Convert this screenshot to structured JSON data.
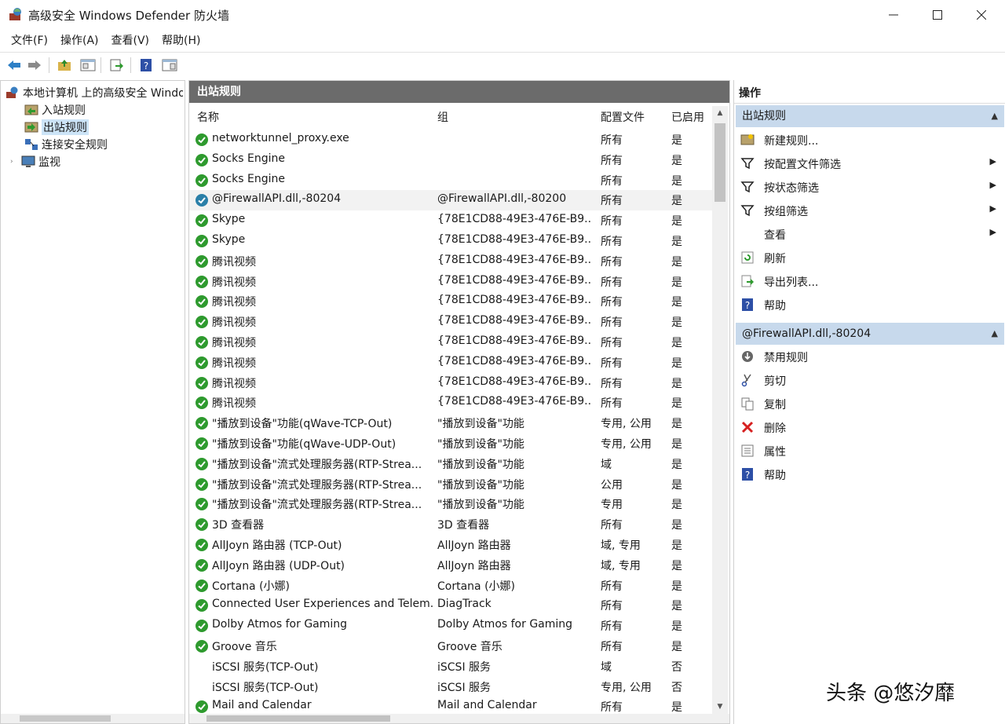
{
  "window": {
    "title": "高级安全 Windows Defender 防火墙"
  },
  "menu": [
    "文件(F)",
    "操作(A)",
    "查看(V)",
    "帮助(H)"
  ],
  "tree": {
    "root": "本地计算机 上的高级安全 Windows",
    "items": [
      {
        "label": "入站规则"
      },
      {
        "label": "出站规则"
      },
      {
        "label": "连接安全规则"
      },
      {
        "label": "监视"
      }
    ]
  },
  "center": {
    "header": "出站规则",
    "columns": {
      "name": "名称",
      "group": "组",
      "profile": "配置文件",
      "enabled": "已启用"
    },
    "rows": [
      {
        "icon": "green-check",
        "name": "networktunnel_proxy.exe",
        "group": "",
        "profile": "所有",
        "enabled": "是"
      },
      {
        "icon": "green-check",
        "name": "Socks Engine",
        "group": "",
        "profile": "所有",
        "enabled": "是"
      },
      {
        "icon": "green-check",
        "name": "Socks Engine",
        "group": "",
        "profile": "所有",
        "enabled": "是"
      },
      {
        "icon": "blue-check",
        "name": "@FirewallAPI.dll,-80204",
        "group": "@FirewallAPI.dll,-80200",
        "profile": "所有",
        "enabled": "是",
        "selected": true
      },
      {
        "icon": "green-check",
        "name": "Skype",
        "group": "{78E1CD88-49E3-476E-B9...",
        "profile": "所有",
        "enabled": "是"
      },
      {
        "icon": "green-check",
        "name": "Skype",
        "group": "{78E1CD88-49E3-476E-B9...",
        "profile": "所有",
        "enabled": "是"
      },
      {
        "icon": "green-check",
        "name": "腾讯视频",
        "group": "{78E1CD88-49E3-476E-B9...",
        "profile": "所有",
        "enabled": "是"
      },
      {
        "icon": "green-check",
        "name": "腾讯视频",
        "group": "{78E1CD88-49E3-476E-B9...",
        "profile": "所有",
        "enabled": "是"
      },
      {
        "icon": "green-check",
        "name": "腾讯视频",
        "group": "{78E1CD88-49E3-476E-B9...",
        "profile": "所有",
        "enabled": "是"
      },
      {
        "icon": "green-check",
        "name": "腾讯视频",
        "group": "{78E1CD88-49E3-476E-B9...",
        "profile": "所有",
        "enabled": "是"
      },
      {
        "icon": "green-check",
        "name": "腾讯视频",
        "group": "{78E1CD88-49E3-476E-B9...",
        "profile": "所有",
        "enabled": "是"
      },
      {
        "icon": "green-check",
        "name": "腾讯视频",
        "group": "{78E1CD88-49E3-476E-B9...",
        "profile": "所有",
        "enabled": "是"
      },
      {
        "icon": "green-check",
        "name": "腾讯视频",
        "group": "{78E1CD88-49E3-476E-B9...",
        "profile": "所有",
        "enabled": "是"
      },
      {
        "icon": "green-check",
        "name": "腾讯视频",
        "group": "{78E1CD88-49E3-476E-B9...",
        "profile": "所有",
        "enabled": "是"
      },
      {
        "icon": "green-check",
        "name": "\"播放到设备\"功能(qWave-TCP-Out)",
        "group": "\"播放到设备\"功能",
        "profile": "专用, 公用",
        "enabled": "是"
      },
      {
        "icon": "green-check",
        "name": "\"播放到设备\"功能(qWave-UDP-Out)",
        "group": "\"播放到设备\"功能",
        "profile": "专用, 公用",
        "enabled": "是"
      },
      {
        "icon": "green-check",
        "name": "\"播放到设备\"流式处理服务器(RTP-Strea...",
        "group": "\"播放到设备\"功能",
        "profile": "域",
        "enabled": "是"
      },
      {
        "icon": "green-check",
        "name": "\"播放到设备\"流式处理服务器(RTP-Strea...",
        "group": "\"播放到设备\"功能",
        "profile": "公用",
        "enabled": "是"
      },
      {
        "icon": "green-check",
        "name": "\"播放到设备\"流式处理服务器(RTP-Strea...",
        "group": "\"播放到设备\"功能",
        "profile": "专用",
        "enabled": "是"
      },
      {
        "icon": "green-check",
        "name": "3D 查看器",
        "group": "3D 查看器",
        "profile": "所有",
        "enabled": "是"
      },
      {
        "icon": "green-check",
        "name": "AllJoyn 路由器 (TCP-Out)",
        "group": "AllJoyn 路由器",
        "profile": "域, 专用",
        "enabled": "是"
      },
      {
        "icon": "green-check",
        "name": "AllJoyn 路由器 (UDP-Out)",
        "group": "AllJoyn 路由器",
        "profile": "域, 专用",
        "enabled": "是"
      },
      {
        "icon": "green-check",
        "name": "Cortana (小娜)",
        "group": "Cortana (小娜)",
        "profile": "所有",
        "enabled": "是"
      },
      {
        "icon": "green-check",
        "name": "Connected User Experiences and Telem...",
        "group": "DiagTrack",
        "profile": "所有",
        "enabled": "是"
      },
      {
        "icon": "green-check",
        "name": "Dolby Atmos for Gaming",
        "group": "Dolby Atmos for Gaming",
        "profile": "所有",
        "enabled": "是"
      },
      {
        "icon": "green-check",
        "name": "Groove 音乐",
        "group": "Groove 音乐",
        "profile": "所有",
        "enabled": "是"
      },
      {
        "icon": "none",
        "name": "iSCSI 服务(TCP-Out)",
        "group": "iSCSI 服务",
        "profile": "域",
        "enabled": "否"
      },
      {
        "icon": "none",
        "name": "iSCSI 服务(TCP-Out)",
        "group": "iSCSI 服务",
        "profile": "专用, 公用",
        "enabled": "否"
      },
      {
        "icon": "green-check",
        "name": "Mail and Calendar",
        "group": "Mail and Calendar",
        "profile": "所有",
        "enabled": "是"
      }
    ]
  },
  "actions": {
    "title": "操作",
    "section1": {
      "header": "出站规则",
      "items": [
        {
          "label": "新建规则...",
          "icon": "new-rule-icon",
          "submenu": false
        },
        {
          "label": "按配置文件筛选",
          "icon": "filter-icon",
          "submenu": true
        },
        {
          "label": "按状态筛选",
          "icon": "filter-icon",
          "submenu": true
        },
        {
          "label": "按组筛选",
          "icon": "filter-icon",
          "submenu": true
        },
        {
          "label": "查看",
          "icon": "none",
          "submenu": true
        },
        {
          "label": "刷新",
          "icon": "refresh-icon",
          "submenu": false
        },
        {
          "label": "导出列表...",
          "icon": "export-icon",
          "submenu": false
        },
        {
          "label": "帮助",
          "icon": "help-icon",
          "submenu": false
        }
      ]
    },
    "section2": {
      "header": "@FirewallAPI.dll,-80204",
      "items": [
        {
          "label": "禁用规则",
          "icon": "disable-icon"
        },
        {
          "label": "剪切",
          "icon": "cut-icon"
        },
        {
          "label": "复制",
          "icon": "copy-icon"
        },
        {
          "label": "删除",
          "icon": "delete-icon"
        },
        {
          "label": "属性",
          "icon": "properties-icon"
        },
        {
          "label": "帮助",
          "icon": "help-icon"
        }
      ]
    }
  },
  "watermark": "头条 @悠汐靡"
}
